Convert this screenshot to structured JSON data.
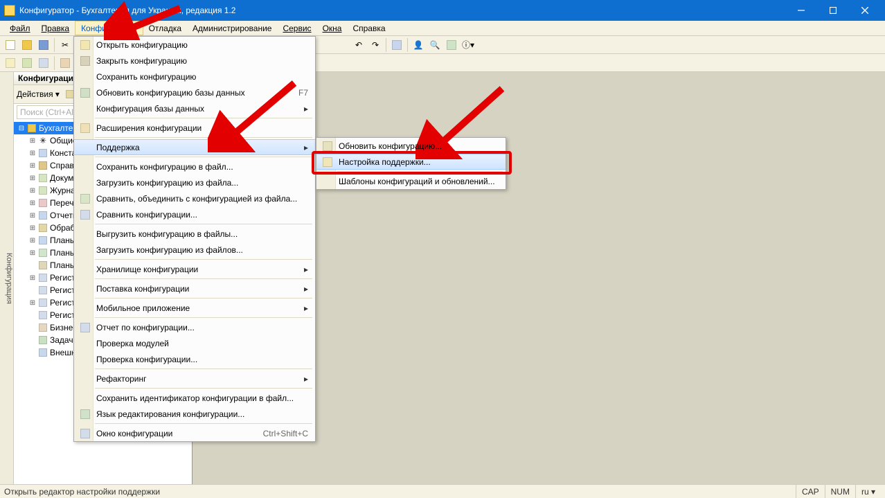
{
  "window": {
    "title": "Конфигуратор - Бухгалтерия для Украины, редакция 1.2"
  },
  "menubar": {
    "file": "Файл",
    "edit": "Правка",
    "config": "Конфигурация",
    "debug": "Отладка",
    "admin": "Администрирование",
    "service": "Сервис",
    "windows": "Окна",
    "help": "Справка"
  },
  "panel": {
    "title": "Конфигурация",
    "actions": "Действия ▾",
    "search_placeholder": "Поиск (Ctrl+Alt+M)"
  },
  "tree": {
    "root": "Бухгалтерия",
    "items": [
      "Общие",
      "Константы",
      "Справочники",
      "Документы",
      "Журналы документов",
      "Перечисления",
      "Отчеты",
      "Обработки",
      "Планы видов характеристик",
      "Планы счетов",
      "Планы видов расчета",
      "Регистры сведений",
      "Регистры накопления",
      "Регистры бухгалтерии",
      "Регистры расчета",
      "Бизнес-процессы",
      "Задачи",
      "Внешние источники данных"
    ]
  },
  "config_menu": {
    "open": "Открыть конфигурацию",
    "close": "Закрыть конфигурацию",
    "save": "Сохранить конфигурацию",
    "update_db": "Обновить конфигурацию базы данных",
    "update_db_kbd": "F7",
    "db_config": "Конфигурация базы данных",
    "extensions": "Расширения конфигурации",
    "support": "Поддержка",
    "save_to_file": "Сохранить конфигурацию в файл...",
    "load_from_file": "Загрузить конфигурацию из файла...",
    "compare_merge": "Сравнить, объединить с конфигурацией из файла...",
    "compare": "Сравнить конфигурации...",
    "export_files": "Выгрузить конфигурацию в файлы...",
    "import_files": "Загрузить конфигурацию из файлов...",
    "repo": "Хранилище конфигурации",
    "delivery": "Поставка конфигурации",
    "mobile": "Мобильное приложение",
    "report": "Отчет по конфигурации...",
    "check_modules": "Проверка модулей",
    "check_config": "Проверка конфигурации...",
    "refactoring": "Рефакторинг",
    "save_id": "Сохранить идентификатор конфигурации в файл...",
    "edit_lang": "Язык редактирования конфигурации...",
    "config_window": "Окно конфигурации",
    "config_window_kbd": "Ctrl+Shift+C"
  },
  "support_submenu": {
    "update": "Обновить конфигурацию...",
    "settings": "Настройка поддержки...",
    "templates": "Шаблоны конфигураций и обновлений..."
  },
  "statusbar": {
    "hint": "Открыть редактор настройки поддержки",
    "cap": "CAP",
    "num": "NUM",
    "lang": "ru ▾"
  },
  "side_tab": "Конфигурация"
}
